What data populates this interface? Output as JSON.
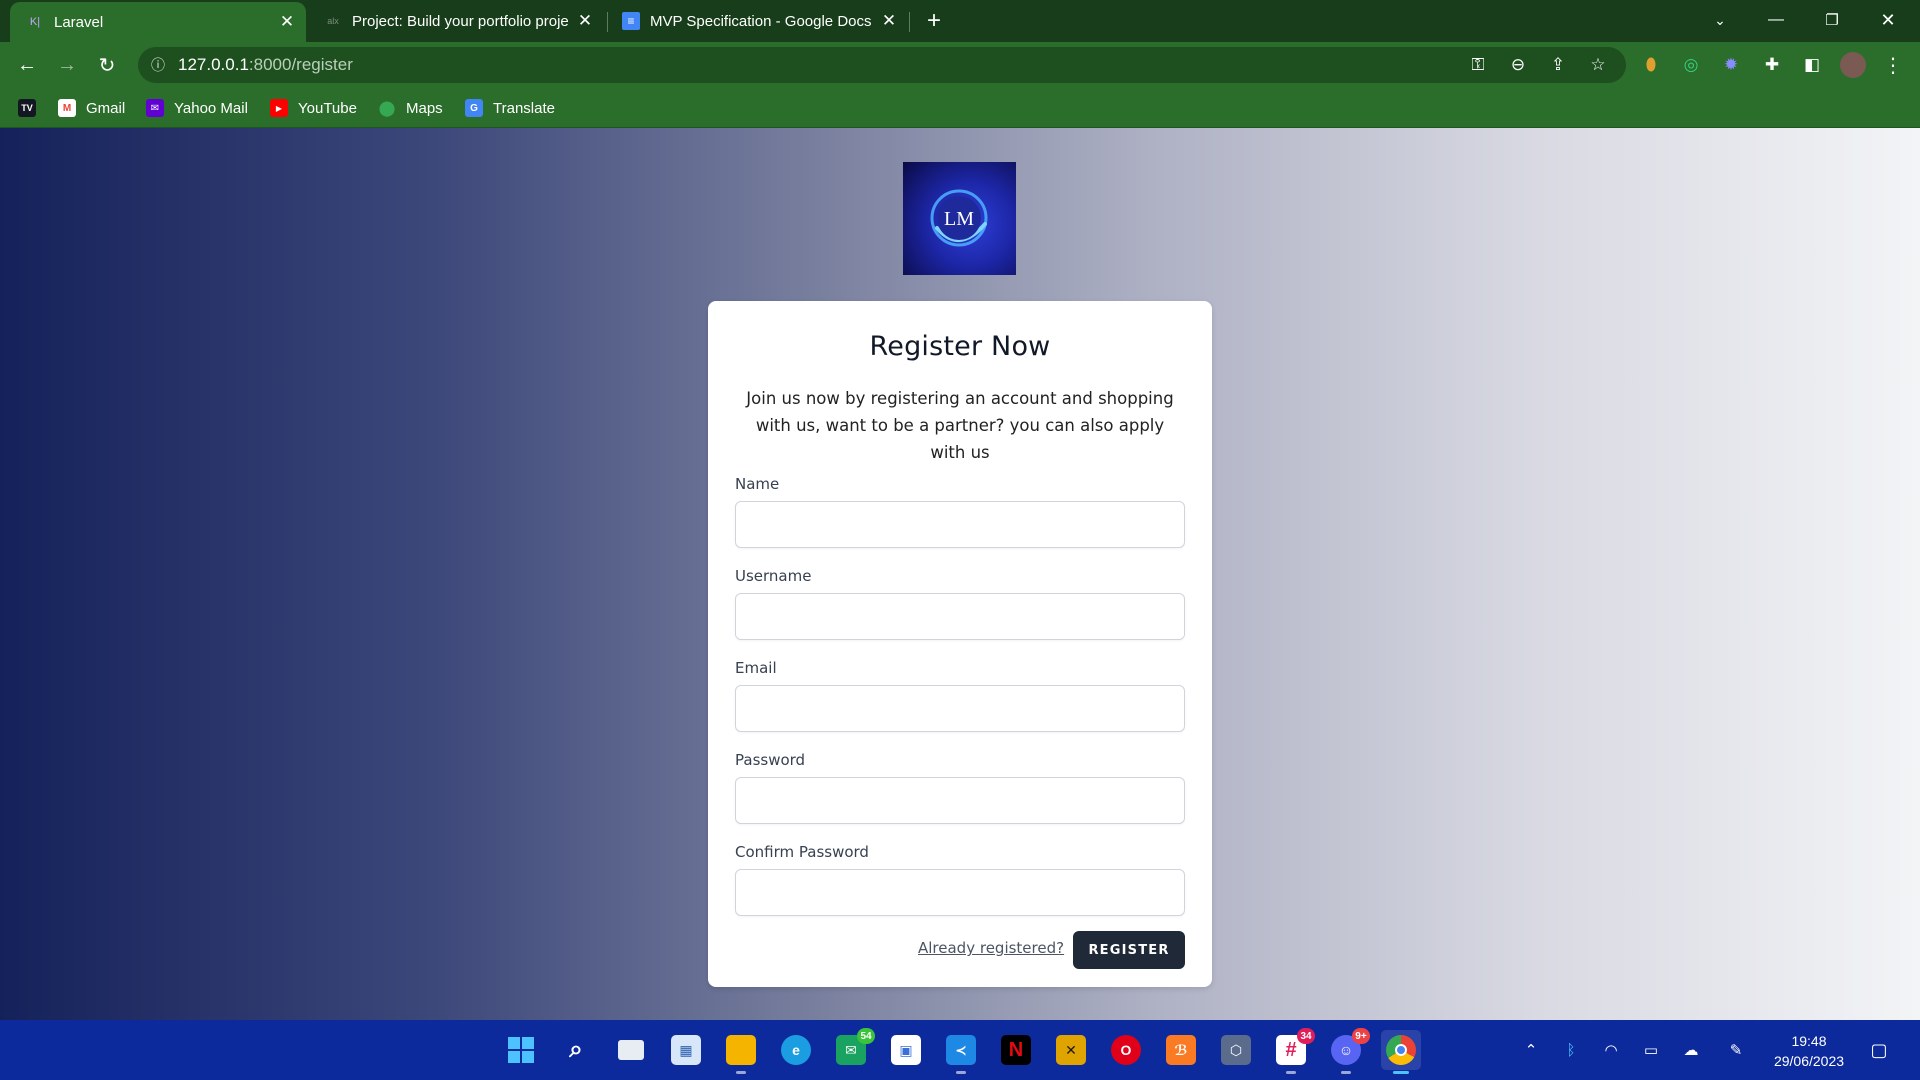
{
  "browser": {
    "tabs": [
      {
        "title": "Laravel",
        "favicon": "laravel-icon",
        "active": true
      },
      {
        "title": "Project: Build your portfolio proje",
        "favicon": "alx-icon",
        "active": false
      },
      {
        "title": "MVP Specification - Google Docs",
        "favicon": "google-docs-icon",
        "active": false
      }
    ],
    "new_tab_label": "+",
    "url_host": "127.0.0.1",
    "url_rest": ":8000/register",
    "bookmarks": [
      {
        "label": "",
        "icon": "tradingview-icon",
        "glyph": "TV",
        "color": "#131722"
      },
      {
        "label": "Gmail",
        "icon": "gmail-icon",
        "glyph": "M",
        "color": "#ea4335"
      },
      {
        "label": "Yahoo Mail",
        "icon": "yahoo-mail-icon",
        "glyph": "✉",
        "color": "#6001d2"
      },
      {
        "label": "YouTube",
        "icon": "youtube-icon",
        "glyph": "▶",
        "color": "#ff0000"
      },
      {
        "label": "Maps",
        "icon": "maps-icon",
        "glyph": "●",
        "color": "#34a853"
      },
      {
        "label": "Translate",
        "icon": "translate-icon",
        "glyph": "G",
        "color": "#4285f4"
      }
    ]
  },
  "form": {
    "title": "Register Now",
    "lead": "Join us now by registering an account and shopping with us, want to be a partner? you can also apply with us",
    "fields": [
      {
        "label": "Name",
        "value": ""
      },
      {
        "label": "Username",
        "value": ""
      },
      {
        "label": "Email",
        "value": ""
      },
      {
        "label": "Password",
        "value": ""
      },
      {
        "label": "Confirm Password",
        "value": ""
      }
    ],
    "login_link": "Already registered?",
    "submit_label": "REGISTER",
    "logo_text": "LM"
  },
  "taskbar": {
    "apps": [
      {
        "name": "start-button",
        "glyph": "⊞",
        "color": "#4cc2ff"
      },
      {
        "name": "search-button",
        "glyph": "⌕",
        "color": "transparent"
      },
      {
        "name": "task-view-button",
        "glyph": "❐",
        "color": "#8e9bb0"
      },
      {
        "name": "widgets-button",
        "glyph": "▦",
        "color": "#6aa7e8"
      },
      {
        "name": "file-explorer-app",
        "glyph": "▬",
        "color": "#f4b400"
      },
      {
        "name": "edge-app",
        "glyph": "e",
        "color": "#1b9de2"
      },
      {
        "name": "mail-app",
        "glyph": "✉",
        "color": "#1aa260",
        "badge": "54"
      },
      {
        "name": "store-app",
        "glyph": "▣",
        "color": "#3b6fd8"
      },
      {
        "name": "vscode-app",
        "glyph": "≺",
        "color": "#1e88e5"
      },
      {
        "name": "netflix-app",
        "glyph": "N",
        "color": "#000000"
      },
      {
        "name": "games-app",
        "glyph": "✕",
        "color": "#e0a400"
      },
      {
        "name": "opera-app",
        "glyph": "O",
        "color": "#e0001a"
      },
      {
        "name": "xampp-app",
        "glyph": "ℬ",
        "color": "#fb7a24"
      },
      {
        "name": "virtualbox-app",
        "glyph": "⬡",
        "color": "#5a6b8c"
      },
      {
        "name": "slack-app",
        "glyph": "#",
        "color": "#e01e5a",
        "badge": "34"
      },
      {
        "name": "discord-app",
        "glyph": "☺",
        "color": "#5865f2",
        "badge": "9+"
      },
      {
        "name": "chrome-app",
        "glyph": "◉",
        "color": "#34a853"
      }
    ],
    "clock_time": "19:48",
    "clock_date": "29/06/2023"
  }
}
